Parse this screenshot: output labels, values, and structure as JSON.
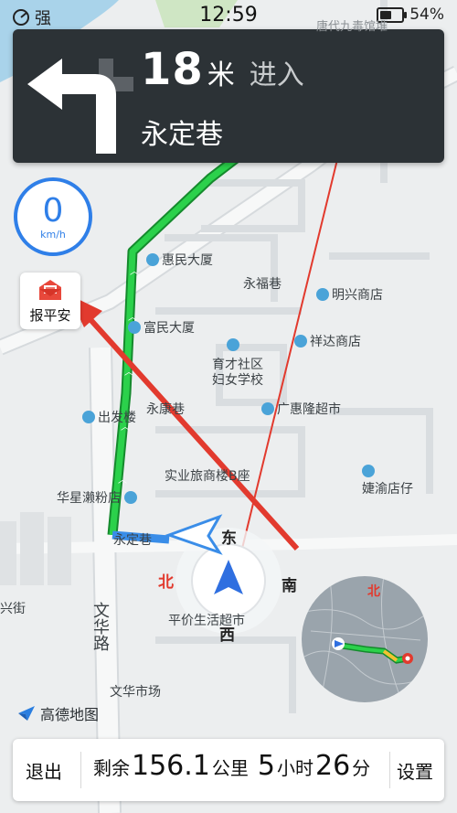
{
  "status_bar": {
    "signal": "强",
    "time": "12:59",
    "battery": "54%",
    "battery_level": 0.54
  },
  "nav_card": {
    "distance": "18",
    "distance_unit": "米",
    "action": "进入",
    "road": "永定巷"
  },
  "speed": {
    "value": "0",
    "unit": "km/h"
  },
  "report_button": {
    "label": "报平安"
  },
  "map_labels": {
    "huimin": "惠民大厦",
    "yongfu": "永福巷",
    "mingxing": "明兴商店",
    "fuming": "富民大厦",
    "xiangda": "祥达商店",
    "yucai1": "育才社区",
    "yucai2": "妇女学校",
    "chufa": "出发楼",
    "yongkang": "永康巷",
    "guanghui": "广惠隆超市",
    "shiye": "实业旅商楼B座",
    "jieyu": "婕渝店仔",
    "huaxing": "华星濑粉店",
    "yongding": "永定巷",
    "pingjia": "平价生活超市",
    "wenhua_road": "文华路",
    "wenhua_market": "文华市场",
    "tangdai": "唐代九毒馆堆",
    "xingjie": "兴街"
  },
  "compass": {
    "north": "北",
    "south": "南",
    "east": "东",
    "west": "西",
    "minimap_north": "北"
  },
  "logo": {
    "text": "高德地图"
  },
  "bottom_bar": {
    "exit": "退出",
    "remain_prefix": "剩余",
    "remain_distance": "156.1",
    "distance_unit": "公里",
    "hours": "5",
    "hours_unit": "小时",
    "minutes": "26",
    "minutes_unit": "分",
    "settings": "设置"
  },
  "colors": {
    "route_green": "#1fb53a",
    "nav_card_bg": "#2c3236",
    "speed_blue": "#2f7fe8",
    "annotation_red": "#e23a2e"
  }
}
